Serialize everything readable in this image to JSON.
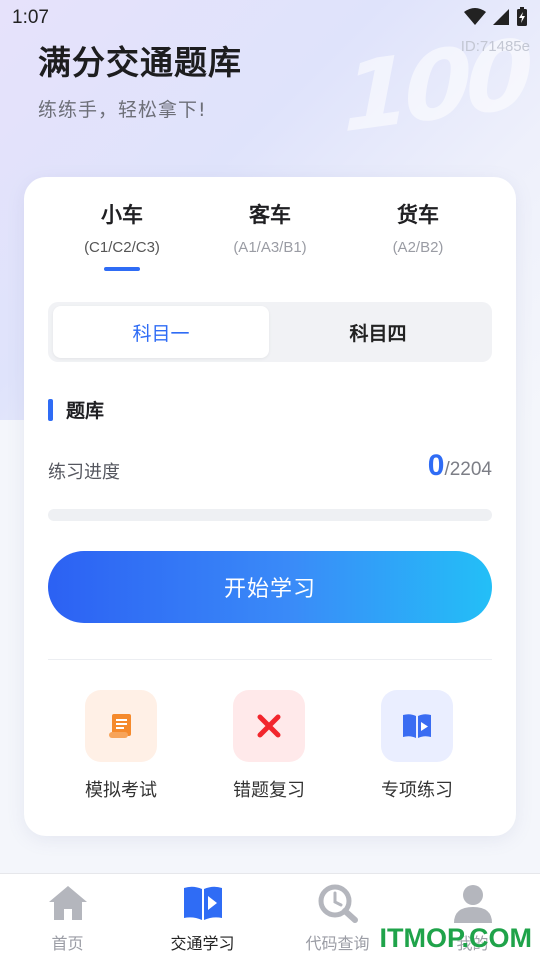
{
  "status_bar": {
    "time": "1:07"
  },
  "page_id": "ID:71485e",
  "header": {
    "title": "满分交通题库",
    "subtitle": "练练手，轻松拿下!",
    "decoration_text": "100"
  },
  "vehicle_tabs": [
    {
      "name": "小车",
      "sub": "(C1/C2/C3)",
      "active": true
    },
    {
      "name": "客车",
      "sub": "(A1/A3/B1)",
      "active": false
    },
    {
      "name": "货车",
      "sub": "(A2/B2)",
      "active": false
    }
  ],
  "subject_tabs": [
    {
      "label": "科目一",
      "active": true
    },
    {
      "label": "科目四",
      "active": false
    }
  ],
  "question_bank": {
    "section_title": "题库",
    "progress_label": "练习进度",
    "done": "0",
    "total": "/2204",
    "progress_fraction": 0
  },
  "start_button": {
    "label": "开始学习"
  },
  "tools": [
    {
      "label": "模拟考试",
      "icon": "exam-scroll-icon",
      "bg": "#fff0e6",
      "color": "#f58a2c"
    },
    {
      "label": "错题复习",
      "icon": "cross-icon",
      "bg": "#ffe9ea",
      "color": "#f2262d"
    },
    {
      "label": "专项练习",
      "icon": "video-book-icon",
      "bg": "#eaeeff",
      "color": "#3a6cf2"
    }
  ],
  "bottom_nav": [
    {
      "label": "首页",
      "icon": "home-icon",
      "active": false
    },
    {
      "label": "交通学习",
      "icon": "book-play-icon",
      "active": true
    },
    {
      "label": "代码查询",
      "icon": "search-icon",
      "active": false
    },
    {
      "label": "我的",
      "icon": "user-icon",
      "active": false
    }
  ],
  "colors": {
    "accent": "#2f6cf5",
    "watermark": "#1fa34a"
  },
  "watermark": "ITMOP.COM"
}
